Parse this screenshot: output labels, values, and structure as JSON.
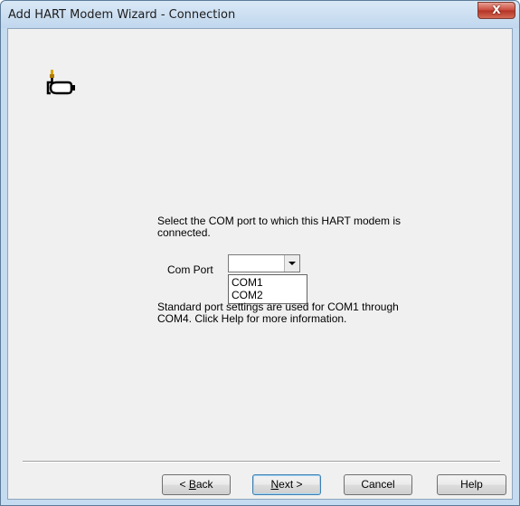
{
  "window": {
    "title": "Add HART Modem Wizard - Connection",
    "close_glyph": "X"
  },
  "content": {
    "description": "Select the COM port to which this HART modem is connected.",
    "com_port_label": "Com Port",
    "com_port_value": "",
    "com_port_options": [
      "COM1",
      "COM2"
    ],
    "hint": "Standard port settings are used for COM1 through COM4.  Click Help for more information."
  },
  "buttons": {
    "back": {
      "pre": "< ",
      "mnemonic": "B",
      "rest": "ack"
    },
    "next": {
      "pre": "",
      "mnemonic": "N",
      "rest": "ext >"
    },
    "cancel": "Cancel",
    "help": "Help"
  },
  "icons": {
    "modem": "modem-plug-icon",
    "dropdown_arrow": "chevron-down-icon"
  },
  "colors": {
    "window_frame": "#c4dbf0",
    "client_bg": "#f0f0f0",
    "close_button": "#c9483a"
  }
}
